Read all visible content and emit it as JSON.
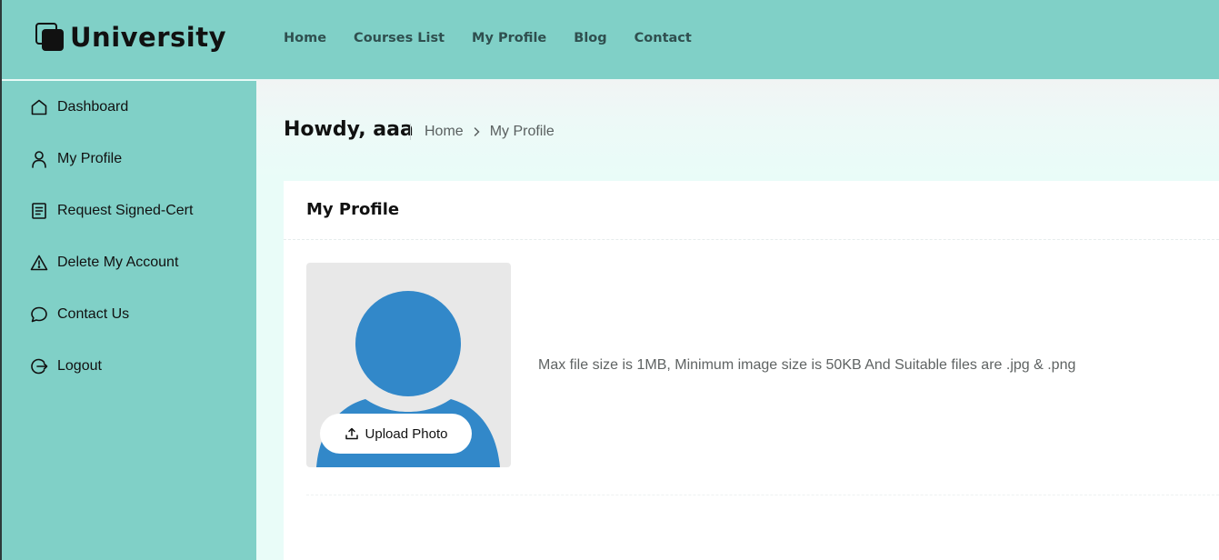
{
  "brand": {
    "name": "University",
    "logo_icon": "copy-squares-icon"
  },
  "nav": {
    "items": [
      {
        "label": "Home"
      },
      {
        "label": "Courses List"
      },
      {
        "label": "My Profile"
      },
      {
        "label": "Blog"
      },
      {
        "label": "Contact"
      }
    ]
  },
  "sidebar": {
    "items": [
      {
        "label": "Dashboard",
        "icon": "home-icon"
      },
      {
        "label": "My Profile",
        "icon": "user-icon"
      },
      {
        "label": "Request Signed-Cert",
        "icon": "document-icon"
      },
      {
        "label": "Delete My Account",
        "icon": "warning-icon"
      },
      {
        "label": "Contact Us",
        "icon": "chat-bubble-icon"
      },
      {
        "label": "Logout",
        "icon": "logout-icon"
      }
    ]
  },
  "page": {
    "greeting": "Howdy, aaa",
    "breadcrumb": {
      "home": "Home",
      "current": "My Profile"
    }
  },
  "profile": {
    "title": "My Profile",
    "upload_label": "Upload Photo",
    "upload_icon": "upload-icon",
    "hint": "Max file size is 1MB, Minimum image size is 50KB And Suitable files are .jpg & .png"
  },
  "colors": {
    "primary": "#80d0c7",
    "background": "#e9fcf8",
    "avatar": "#3288c9"
  }
}
